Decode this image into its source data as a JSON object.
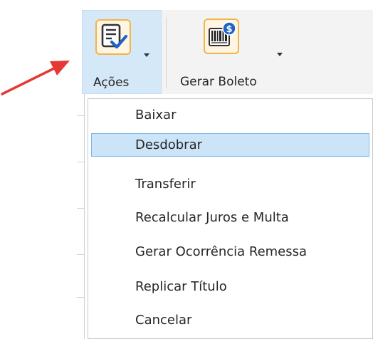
{
  "ribbon": {
    "acoes": {
      "label": "Ações",
      "icon": "checklist-icon"
    },
    "gerar_boleto": {
      "label": "Gerar Boleto",
      "icon": "barcode-money-icon"
    }
  },
  "menu": {
    "items": [
      {
        "label": "Baixar"
      },
      {
        "label": "Desdobrar",
        "selected": true
      },
      {
        "label": "Transferir"
      },
      {
        "label": "Recalcular Juros e Multa"
      },
      {
        "label": "Gerar Ocorrência Remessa"
      },
      {
        "label": "Replicar Título"
      },
      {
        "label": "Cancelar"
      }
    ]
  },
  "colors": {
    "accent_highlight": "#cce4f7",
    "highlight_border": "#7db5e6",
    "annotation_arrow": "#e53935",
    "icon_frame": "#f3b449"
  }
}
